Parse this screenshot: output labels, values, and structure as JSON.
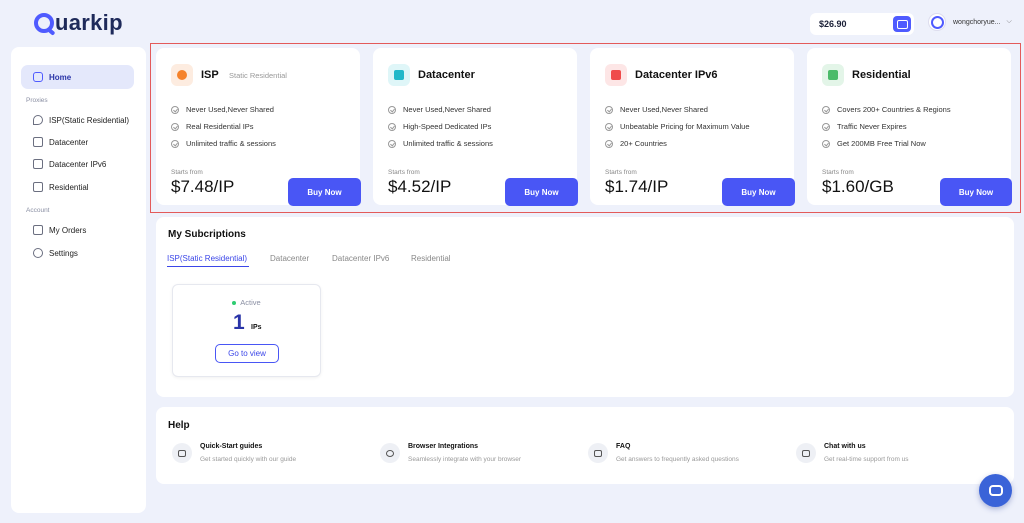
{
  "header": {
    "logo_text": "uarkip",
    "balance": "$26.90",
    "username": "wongchoryue..."
  },
  "sidebar": {
    "home": "Home",
    "proxies_section": "Proxies",
    "items": [
      {
        "label": "ISP(Static Residential)"
      },
      {
        "label": "Datacenter"
      },
      {
        "label": "Datacenter IPv6"
      },
      {
        "label": "Residential"
      }
    ],
    "account_section": "Account",
    "account_items": [
      {
        "label": "My Orders"
      },
      {
        "label": "Settings"
      }
    ]
  },
  "products": [
    {
      "title": "ISP",
      "subtitle": "Static Residential",
      "icon": "location-pin-icon",
      "accent": "#f5822a",
      "features": [
        "Never Used,Never Shared",
        "Real Residential IPs",
        "Unlimited traffic & sessions"
      ],
      "starts_from": "Starts from",
      "price": "$7.48/IP",
      "buy": "Buy Now"
    },
    {
      "title": "Datacenter",
      "subtitle": "",
      "icon": "server-icon",
      "accent": "#22b8c9",
      "features": [
        "Never Used,Never Shared",
        "High-Speed Dedicated IPs",
        "Unlimited traffic & sessions"
      ],
      "starts_from": "Starts from",
      "price": "$4.52/IP",
      "buy": "Buy Now"
    },
    {
      "title": "Datacenter IPv6",
      "subtitle": "",
      "icon": "monitor-icon",
      "accent": "#ef4b4b",
      "features": [
        "Never Used,Never Shared",
        "Unbeatable Pricing for Maximum Value",
        "20+ Countries"
      ],
      "starts_from": "Starts from",
      "price": "$1.74/IP",
      "buy": "Buy Now"
    },
    {
      "title": "Residential",
      "subtitle": "",
      "icon": "home-icon",
      "accent": "#4cbb6a",
      "features": [
        "Covers 200+ Countries & Regions",
        "Traffic Never Expires",
        "Get 200MB Free Trial Now"
      ],
      "starts_from": "Starts from",
      "price": "$1.60/GB",
      "buy": "Buy Now"
    }
  ],
  "subscriptions": {
    "title": "My Subcriptions",
    "tabs": [
      "ISP(Static Residential)",
      "Datacenter",
      "Datacenter IPv6",
      "Residential"
    ],
    "active_tab": 0,
    "card": {
      "status": "Active",
      "count": "1",
      "unit": "IPs",
      "action": "Go to view"
    }
  },
  "help": {
    "title": "Help",
    "items": [
      {
        "title": "Quick-Start guides",
        "desc": "Get started quickly with our guide",
        "icon": "book-icon"
      },
      {
        "title": "Browser Integrations",
        "desc": "Seamlessly integrate with your browser",
        "icon": "globe-icon"
      },
      {
        "title": "FAQ",
        "desc": "Get answers to frequently asked questions",
        "icon": "faq-icon"
      },
      {
        "title": "Chat with us",
        "desc": "Get real-time support from us",
        "icon": "chat-icon"
      }
    ]
  },
  "colors": {
    "accent": "#4956f5",
    "highlight_border": "#e35a5a"
  }
}
